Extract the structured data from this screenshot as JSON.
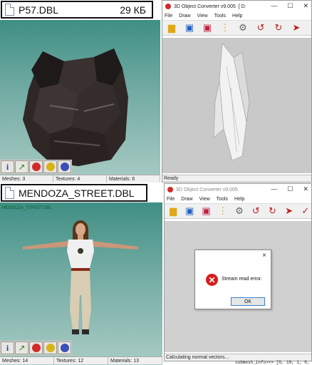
{
  "top": {
    "file_name": "P57.DBL",
    "file_size": "29 КБ",
    "viewer_status": {
      "meshes": "Meshes: 3",
      "textures": "Textures: 4",
      "materials": "Materials: 6"
    },
    "converter": {
      "title": "3D Object Converter v9.005",
      "title_suffix": "[ D:",
      "status": "Ready"
    }
  },
  "bottom": {
    "file_name": "MENDOZA_STREET.DBL",
    "viewer_caption": "MENDOZA_STREET.DBL",
    "viewer_status": {
      "meshes": "Meshes: 14",
      "textures": "Textures: 12",
      "materials": "Materials: 13"
    },
    "converter": {
      "title": "3D Object Converter v9.005",
      "status": "Calculating normal vectors..."
    },
    "dialog": {
      "message": "Stream read error.",
      "ok_label": "OK",
      "close": "×"
    },
    "log_line": "submesh_info>>> [0, 10, 1, 0, 7, 6118,"
  },
  "menu": [
    "File",
    "Draw",
    "View",
    "Tools",
    "Help"
  ],
  "window_controls": {
    "minimize": "—",
    "maximize": "☐",
    "close": "✕"
  },
  "viewer_tools": [
    "info-icon",
    "chart-icon",
    "red-sphere-icon",
    "yellow-sphere-icon",
    "blue-sphere-icon"
  ],
  "converter_tools": [
    "open-folder-icon",
    "save-icon",
    "save-as-icon",
    "tree-icon",
    "gear-icon",
    "rotate-icon",
    "spin-icon",
    "export-icon",
    "check-icon"
  ],
  "colors": {
    "accent_red": "#d42a2a",
    "viewer_bg": "#73aca4",
    "canvas_bg": "#c9c9c9"
  }
}
